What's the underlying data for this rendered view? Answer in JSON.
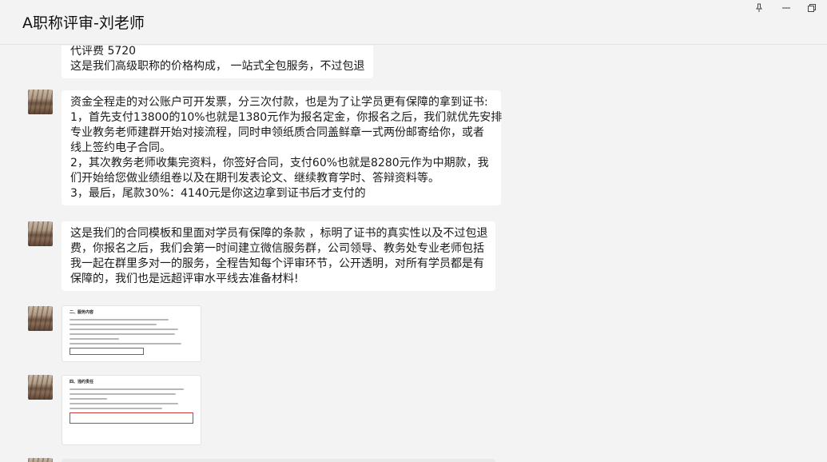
{
  "window": {
    "title": "A职称评审-刘老师",
    "pin_label": "📌",
    "minimize_label": "−",
    "restore_label": "⧉"
  },
  "messages": {
    "m0": {
      "lines": [
        "代评费            5720",
        "这是我们高级职称的价格构成， 一站式全包服务，不过包退"
      ]
    },
    "m1": {
      "lines": [
        "资金全程走的对公账户可开发票，分三次付款，也是为了让学员更有保障的拿到证书:",
        "1，首先支付13800的10%也就是1380元作为报名定金，你报名之后，我们就优先安排",
        "专业教务老师建群开始对接流程，同时申领纸质合同盖鲜章一式两份邮寄给你，或者",
        "线上签约电子合同。",
        "2，其次教务老师收集完资料，你签好合同，支付60%也就是8280元作为中期款，我",
        "们开始给您做业绩组卷以及在期刊发表论文、继续教育学时、答辩资料等。",
        "3，最后，尾款30%：4140元是你这边拿到证书后才支付的"
      ]
    },
    "m2": {
      "lines": [
        "这是我们的合同模板和里面对学员有保障的条款 ，标明了证书的真实性以及不过包退",
        "费，你报名之后，我们会第一时间建立微信服务群，公司领导、教务处专业老师包括",
        "我一起在群里多对一的服务，全程告知每个评审环节，公开透明，对所有学员都是有",
        "保障的，我们也是远超评审水平线去准备材料!"
      ]
    },
    "img1": {
      "heading": "二、服务内容"
    },
    "img2": {
      "heading": "四、违约责任"
    }
  }
}
